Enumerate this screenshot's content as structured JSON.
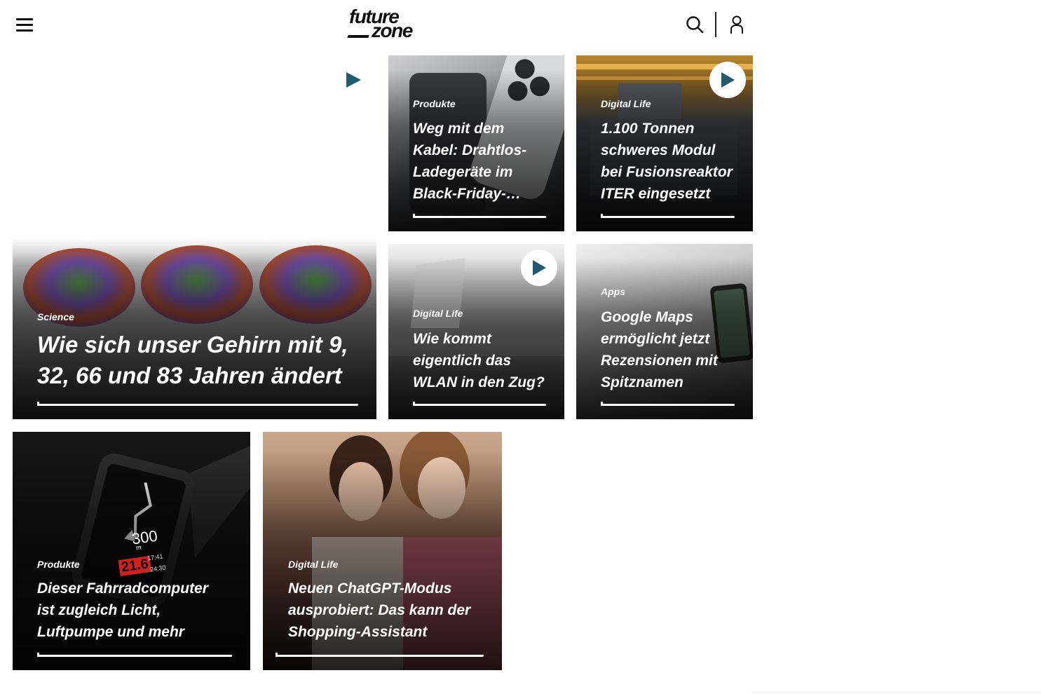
{
  "header": {
    "logo_top": "future",
    "logo_bottom": "zone",
    "menu_icon": "hamburger-menu-icon",
    "search_icon": "search-icon",
    "user_icon": "user-icon"
  },
  "articles": [
    {
      "category": "Produkte",
      "title": "Weg mit dem Kabel: Drahtlos-Ladegeräte im Black-Friday-…",
      "video": false
    },
    {
      "category": "Digital Life",
      "title": "1.100 Tonnen schweres Modul bei Fusionsreaktor ITER eingesetzt",
      "video": true
    },
    {
      "category": "Science",
      "title": "Wie sich unser Gehirn mit 9, 32, 66 und 83 Jahren ändert",
      "video": false
    },
    {
      "category": "Digital Life",
      "title": "Wie kommt eigentlich das WLAN in den Zug?",
      "video": true
    },
    {
      "category": "Apps",
      "title": "Google Maps ermöglicht jetzt Rezensionen mit Spitznamen",
      "video": false
    },
    {
      "category": "Produkte",
      "title": "Dieser Fahrradcomputer ist zugleich Licht, Luftpumpe und mehr",
      "video": false
    },
    {
      "category": "Digital Life",
      "title": "Neuen ChatGPT-Modus ausprobiert: Das kann der Shopping-Assistant",
      "video": false
    }
  ],
  "bike_display": {
    "distance": "300",
    "unit": "m",
    "speed": "21.6",
    "time": "17:41",
    "clock": "24:30"
  },
  "colors": {
    "accent": "#1f5a6e",
    "text": "#ffffff",
    "ink": "#111111"
  }
}
